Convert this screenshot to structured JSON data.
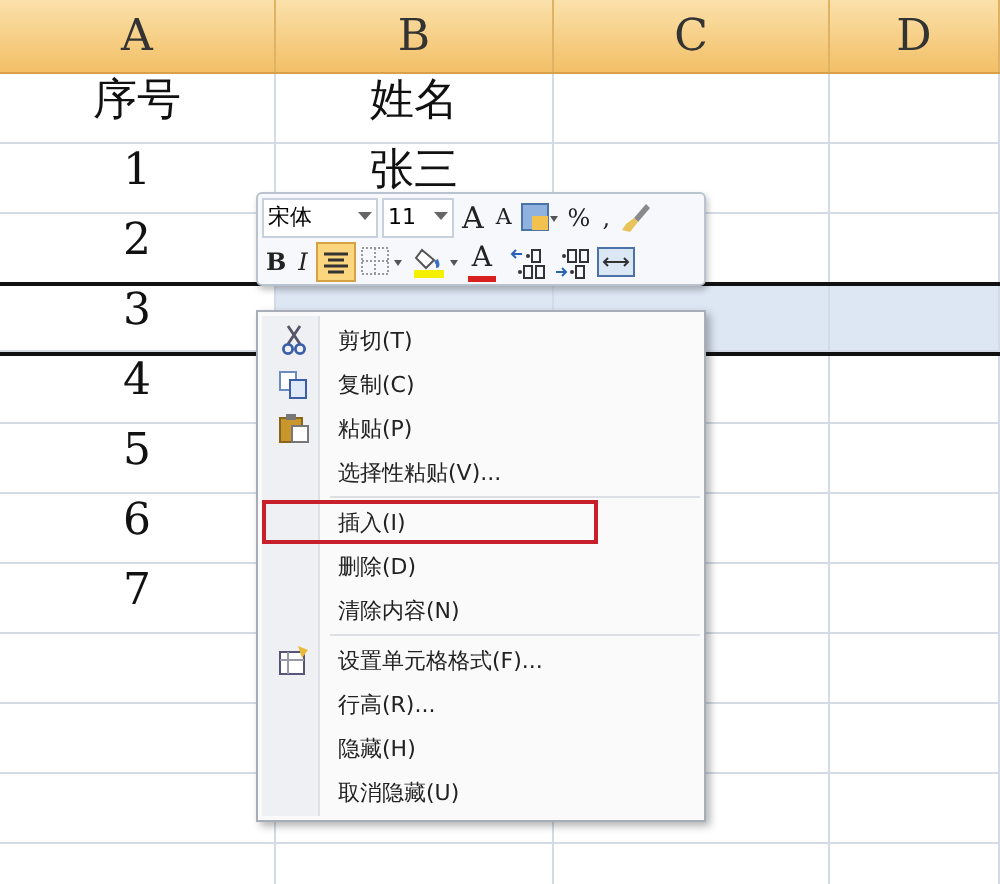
{
  "columns": [
    {
      "label": "A"
    },
    {
      "label": "B"
    },
    {
      "label": "C"
    },
    {
      "label": "D"
    }
  ],
  "rows": [
    {
      "cells": [
        "序号",
        "姓名"
      ],
      "selected": false
    },
    {
      "cells": [
        "1",
        "张三"
      ],
      "selected": false
    },
    {
      "cells": [
        "2"
      ],
      "selected": false
    },
    {
      "cells": [
        "3"
      ],
      "selected": true
    },
    {
      "cells": [
        "4"
      ],
      "selected": false
    },
    {
      "cells": [
        "5"
      ],
      "selected": false
    },
    {
      "cells": [
        "6"
      ],
      "selected": false
    },
    {
      "cells": [
        "7"
      ],
      "selected": false
    }
  ],
  "mini_toolbar": {
    "font": "宋体",
    "size": "11",
    "top_buttons": [
      {
        "kind": "grow",
        "text": "A"
      },
      {
        "kind": "shrink",
        "text": "A"
      },
      {
        "kind": "format"
      },
      {
        "kind": "char",
        "text": "%"
      },
      {
        "kind": "char",
        "text": ","
      },
      {
        "kind": "brush"
      }
    ],
    "bottom_buttons": [
      {
        "kind": "bold",
        "text": "B",
        "on": false
      },
      {
        "kind": "italic",
        "text": "I",
        "on": false
      },
      {
        "kind": "center",
        "on": true
      },
      {
        "kind": "borders"
      },
      {
        "kind": "fill"
      },
      {
        "kind": "fontcolor",
        "text": "A"
      },
      {
        "kind": "incdec"
      },
      {
        "kind": "decdec"
      },
      {
        "kind": "merge"
      }
    ]
  },
  "context_menu": {
    "items": [
      {
        "kind": "cut",
        "label": "剪切(T)",
        "highlighted": false,
        "separator_before": false
      },
      {
        "kind": "copy",
        "label": "复制(C)",
        "highlighted": false,
        "separator_before": false
      },
      {
        "kind": "paste",
        "label": "粘贴(P)",
        "highlighted": false,
        "separator_before": false
      },
      {
        "kind": "plain",
        "label": "选择性粘贴(V)...",
        "highlighted": false,
        "separator_before": false
      },
      {
        "kind": "plain",
        "label": "插入(I)",
        "highlighted": true,
        "separator_before": true
      },
      {
        "kind": "plain",
        "label": "删除(D)",
        "highlighted": false,
        "separator_before": false
      },
      {
        "kind": "plain",
        "label": "清除内容(N)",
        "highlighted": false,
        "separator_before": false
      },
      {
        "kind": "format",
        "label": "设置单元格格式(F)...",
        "highlighted": false,
        "separator_before": true
      },
      {
        "kind": "plain",
        "label": "行高(R)...",
        "highlighted": false,
        "separator_before": false
      },
      {
        "kind": "plain",
        "label": "隐藏(H)",
        "highlighted": false,
        "separator_before": false
      },
      {
        "kind": "plain",
        "label": "取消隐藏(U)",
        "highlighted": false,
        "separator_before": false
      }
    ]
  }
}
